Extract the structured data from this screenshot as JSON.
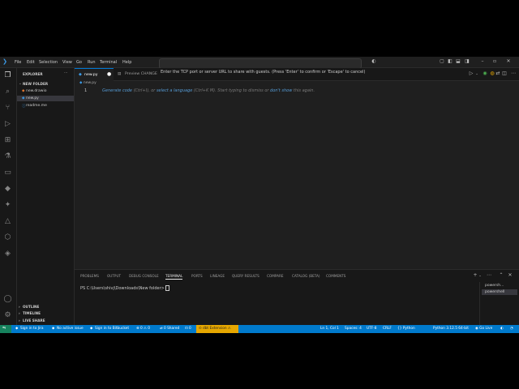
{
  "menu": [
    "File",
    "Edit",
    "Selection",
    "View",
    "Go",
    "Run",
    "Terminal",
    "Help"
  ],
  "command_center": {
    "prompt": "Enter the TCP port or server URL to share with guests. (Press 'Enter' to confirm or 'Escape' to cancel)"
  },
  "sidebar": {
    "title": "EXPLORER",
    "folder": "NEW FOLDER",
    "files": [
      "new.drawio",
      "new.py",
      "readme.me"
    ],
    "sections": [
      "OUTLINE",
      "TIMELINE",
      "LIVE SHARE"
    ]
  },
  "editor": {
    "tab_label": "new.py",
    "preview_tab_label": "Preview CHANGE",
    "breadcrumb": "new.py",
    "line_number": "1",
    "hint": {
      "part1": "Generate code",
      "part2": " (Ctrl+I), or ",
      "part3": "select a language",
      "part4": " (Ctrl+K M). Start typing to dismiss or ",
      "part5": "don't show",
      "part6": " this again."
    }
  },
  "panel": {
    "tabs": [
      "PROBLEMS",
      "OUTPUT",
      "DEBUG CONSOLE",
      "TERMINAL",
      "PORTS",
      "LINEAGE",
      "QUERY RESULTS",
      "COMPARE",
      "CATALOG (BETA)",
      "COMMENTS"
    ],
    "active_tab": "TERMINAL",
    "terminal_line": "PS C:\\Users\\shivj\\Downloads\\New folder> ",
    "terminals": [
      "powersh...",
      "powershell"
    ]
  },
  "status": {
    "jira": "Sign in to Jira",
    "issue": "No active issue",
    "bitbucket": "Sign in to Bitbucket",
    "errors": "0",
    "warnings": "0",
    "shared": "0 Shared",
    "dbt_count": "0",
    "dbt": "dbt Extension",
    "position": "Ln 1, Col 1",
    "spaces": "Spaces: 4",
    "encoding": "UTF-8",
    "eol": "CRLF",
    "language": "Python",
    "interpreter": "Python 3.12.5 64-bit",
    "golive": "Go Live"
  },
  "colors": {
    "accent": "#007acc",
    "remote": "#16825d",
    "dbt": "#e6a700",
    "background": "#1f1f1f"
  }
}
